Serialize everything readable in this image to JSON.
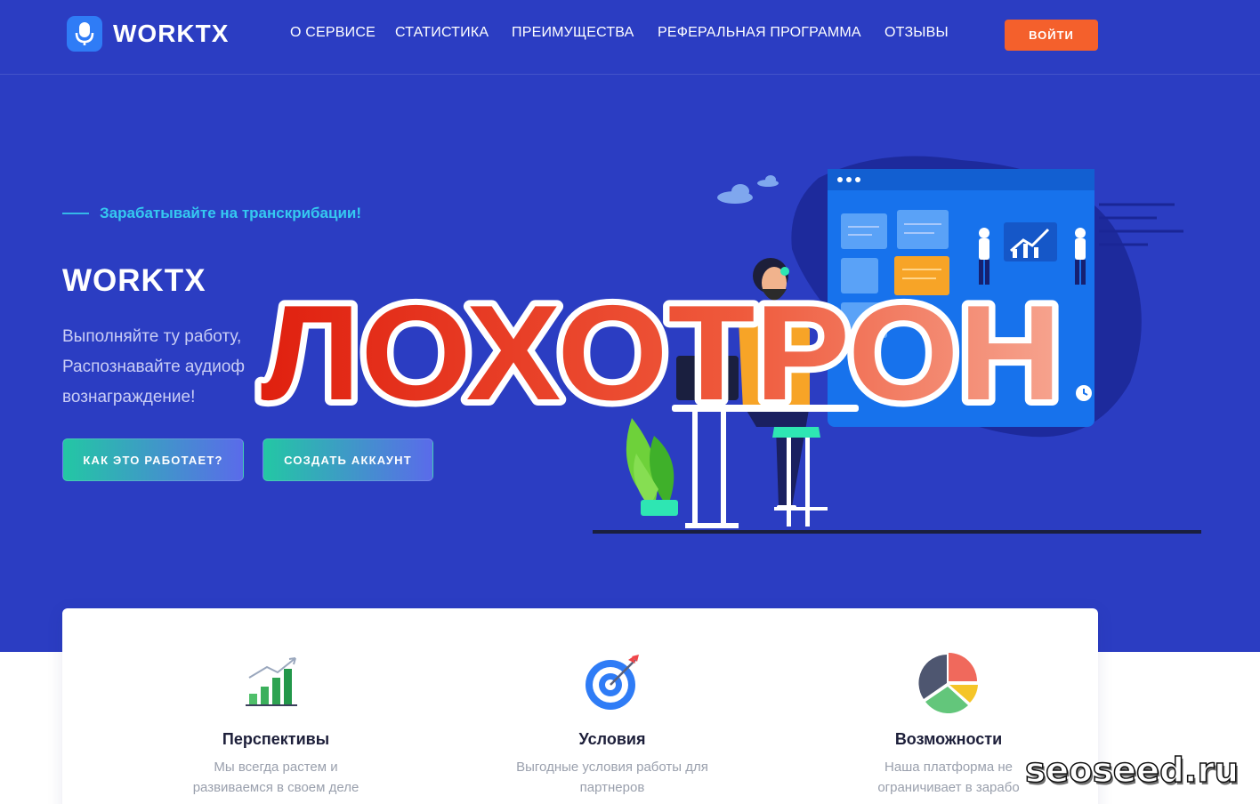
{
  "header": {
    "logo_text": "WORKTX",
    "nav": [
      "О СЕРВИСЕ",
      "СТАТИСТИКА",
      "ПРЕИМУЩЕСТВА",
      "РЕФЕРАЛЬНАЯ ПРОГРАММА",
      "ОТЗЫВЫ"
    ],
    "login_label": "ВОЙТИ"
  },
  "hero": {
    "tagline": "Зарабатывайте на транскрибации!",
    "title": "WORKTX",
    "description_lines": [
      "Выполняйте ту работу,",
      "Распознавайте аудиоф",
      "вознаграждение!"
    ],
    "buttons": {
      "how": "КАК ЭТО РАБОТАЕТ?",
      "create": "СОЗДАТЬ АККАУНТ"
    }
  },
  "overlay": {
    "stamp_text": "ЛОХОТРОН"
  },
  "features": [
    {
      "icon": "growth-chart-icon",
      "title": "Перспективы",
      "desc": [
        "Мы всегда растем и",
        "развиваемся в своем деле"
      ]
    },
    {
      "icon": "target-icon",
      "title": "Условия",
      "desc": [
        "Выгодные условия работы для",
        "партнеров"
      ]
    },
    {
      "icon": "pie-chart-icon",
      "title": "Возможности",
      "desc": [
        "Наша платформа не",
        "ограничивает в зарабо"
      ]
    }
  ],
  "watermark": "seoseed.ru",
  "colors": {
    "hero_bg": "#2b3dc2",
    "accent_orange": "#f4602c",
    "tagline_cyan": "#35c9f0",
    "stamp_red": "#e8321f"
  }
}
